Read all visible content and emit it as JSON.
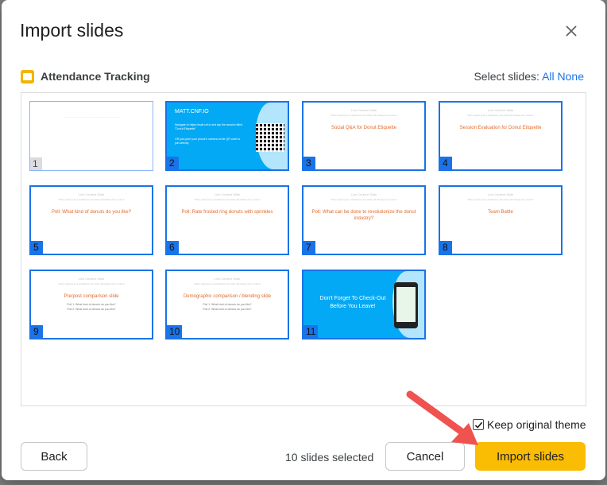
{
  "dialog": {
    "title": "Import slides"
  },
  "presentation": {
    "name": "Attendance Tracking"
  },
  "select_slides": {
    "label": "Select slides:",
    "all": "All",
    "none": "None"
  },
  "slides": [
    {
      "num": "1",
      "selected": false
    },
    {
      "num": "2",
      "selected": true,
      "title": "MATT.CNF.IO",
      "lines": [
        "Navigate to https://matt.cnf.io and tap the session titled \"Donut Etiquette\"",
        "OR just point your phone's camera at the QR code to join directly"
      ]
    },
    {
      "num": "3",
      "selected": true,
      "template": "Live Content Slide",
      "template_sub": "When playing as a slideshow, this slide will display live content",
      "title": "Social Q&A for Donut Etiquette"
    },
    {
      "num": "4",
      "selected": true,
      "template": "Live Content Slide",
      "template_sub": "When playing as a slideshow, this slide will display live content",
      "title": "Session Evaluation for Donut Etiquette"
    },
    {
      "num": "5",
      "selected": true,
      "template": "Live Content Slide",
      "template_sub": "When playing as a slideshow, this slide will display live content",
      "title": "Poll: What kind of donuts do you like?"
    },
    {
      "num": "6",
      "selected": true,
      "template": "Live Content Slide",
      "template_sub": "When playing as a slideshow, this slide will display live content",
      "title": "Poll: Rate frosted ring donuts with sprinkles"
    },
    {
      "num": "7",
      "selected": true,
      "template": "Live Content Slide",
      "template_sub": "When playing as a slideshow, this slide will display live content",
      "title": "Poll: What can be done to revolutionize the donut industry?"
    },
    {
      "num": "8",
      "selected": true,
      "template": "Live Content Slide",
      "template_sub": "When playing as a slideshow, this slide will display live content",
      "title": "Team Battle"
    },
    {
      "num": "9",
      "selected": true,
      "template": "Live Content Slide",
      "template_sub": "When playing as a slideshow, this slide will display live content",
      "title": "Pre/post comparison slide",
      "lines": [
        "Poll 1: What kind of donuts do you like?",
        "Poll 2: What kind of donuts do you like?"
      ]
    },
    {
      "num": "10",
      "selected": true,
      "template": "Live Content Slide",
      "template_sub": "When playing as a slideshow, this slide will display live content",
      "title": "Demographic comparison / blending slide",
      "lines": [
        "Poll 1: What kind of donuts do you like?",
        "Poll 2: What kind of donuts do you like?"
      ]
    },
    {
      "num": "11",
      "selected": true,
      "title": "Don't Forget To Check-Out Before You Leave!"
    }
  ],
  "keep_theme": {
    "label": "Keep original theme",
    "checked": true
  },
  "footer": {
    "back": "Back",
    "count": "10 slides selected",
    "cancel": "Cancel",
    "import": "Import slides"
  },
  "colors": {
    "accent": "#1a73e8",
    "primary_button": "#fbbc04",
    "slide_blue": "#03a9f4",
    "arrow": "#ef5350"
  }
}
